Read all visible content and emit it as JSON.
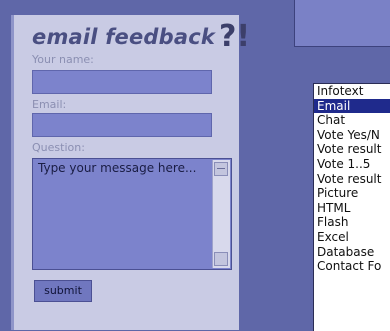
{
  "feedback_form": {
    "title": "email feedback",
    "title_mark": "?!",
    "name_label": "Your name:",
    "email_label": "Email:",
    "question_label": "Question:",
    "message_text": "Type your message here...",
    "submit_label": "submit"
  },
  "listbox": {
    "items": [
      "Infotext",
      "Email",
      "Chat",
      "Vote Yes/N",
      "Vote result",
      "Vote 1..5",
      "Vote result",
      "Picture",
      "HTML",
      "Flash",
      "Excel",
      "Database",
      "Contact Fo"
    ],
    "selected": "Email"
  },
  "colors": {
    "background": "#5f67a8",
    "panel": "#c9cbe4",
    "input_fill": "#7c83cc",
    "selection": "#1f2a8c"
  }
}
